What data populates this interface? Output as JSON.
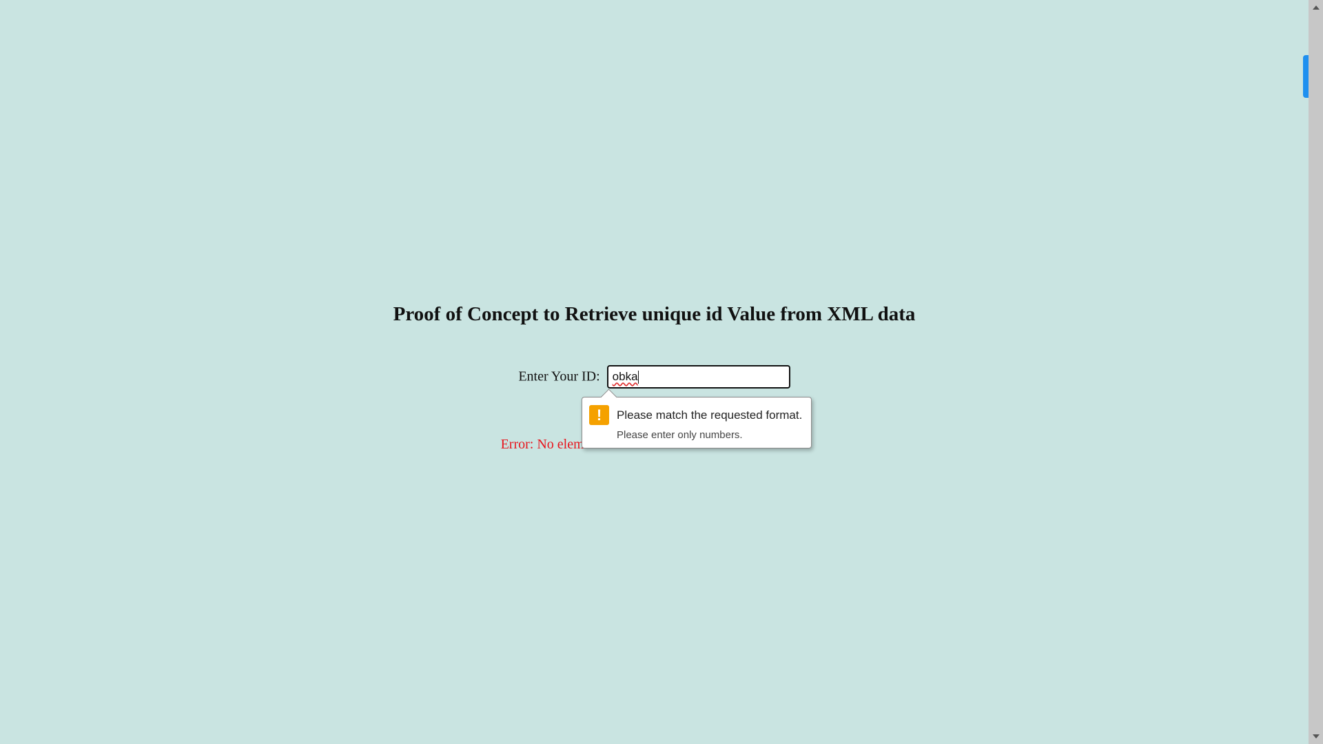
{
  "page": {
    "title": "Proof of Concept to Retrieve unique id Value from XML data",
    "background_color": "#c9e4e1"
  },
  "form": {
    "label": "Enter Your ID:",
    "input_value": "obka"
  },
  "error": {
    "message": "Error: No element with id '4200' found in the XML file.",
    "color": "#e8141c"
  },
  "validation_tooltip": {
    "icon": "warning-icon",
    "title": "Please match the requested format.",
    "subtitle": "Please enter only numbers.",
    "icon_color": "#f5a100"
  },
  "scrollbar": {
    "accent_color": "#1e90f0"
  }
}
